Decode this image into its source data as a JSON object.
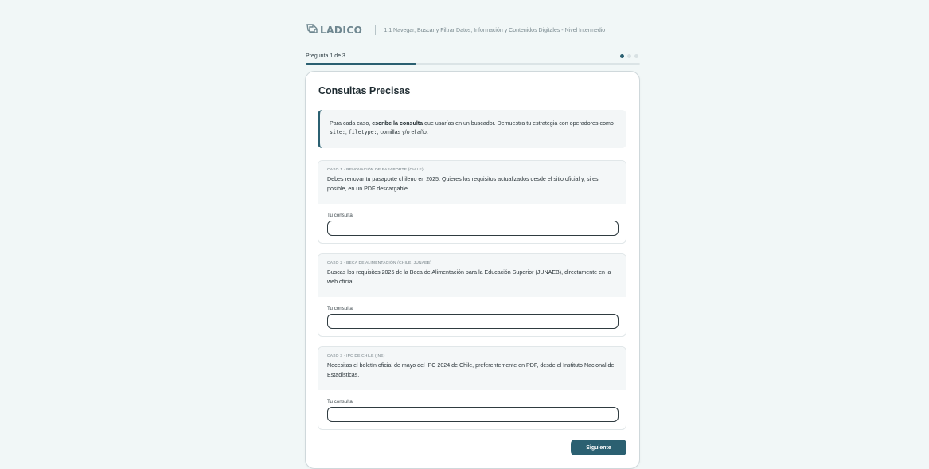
{
  "header": {
    "logo_text": "LADICO",
    "subtitle": "1.1 Navegar, Buscar y Filtrar Datos, Información y Contenidos Digitales - Nivel Intermedio"
  },
  "progress": {
    "label": "Pregunta 1 de 3",
    "current": 1,
    "total": 3,
    "fraction": 0.33,
    "accent_color": "#2b6071"
  },
  "main": {
    "title": "Consultas Precisas",
    "intro": {
      "part1": "Para cada caso, ",
      "bold": "escribe la consulta",
      "part2": " que usarías en un buscador. Demuestra tu estrategia con operadores como ",
      "code1": "site:",
      "sep1": ", ",
      "code2": "filetype:",
      "part3": ", comillas y/o el año."
    },
    "cases": [
      {
        "label": "CASO 1 · RENOVACIÓN DE PASAPORTE (CHILE)",
        "description": "Debes renovar tu pasaporte chileno en 2025. Quieres los requisitos actualizados desde el sitio oficial y, si es posible, en un PDF descargable.",
        "field_label": "Tu consulta",
        "value": ""
      },
      {
        "label": "CASO 2 · BECA DE ALIMENTACIÓN (CHILE, JUNAEB)",
        "description": "Buscas los requisitos 2025 de la Beca de Alimentación para la Educación Superior (JUNAEB), directamente en la web oficial.",
        "field_label": "Tu consulta",
        "value": ""
      },
      {
        "label": "CASO 3 · IPC DE CHILE (INE)",
        "description": "Necesitas el boletín oficial de mayo del IPC 2024 de Chile, preferentemente en PDF, desde el Instituto Nacional de Estadísticas.",
        "field_label": "Tu consulta",
        "value": ""
      }
    ],
    "next_label": "Siguiente"
  }
}
